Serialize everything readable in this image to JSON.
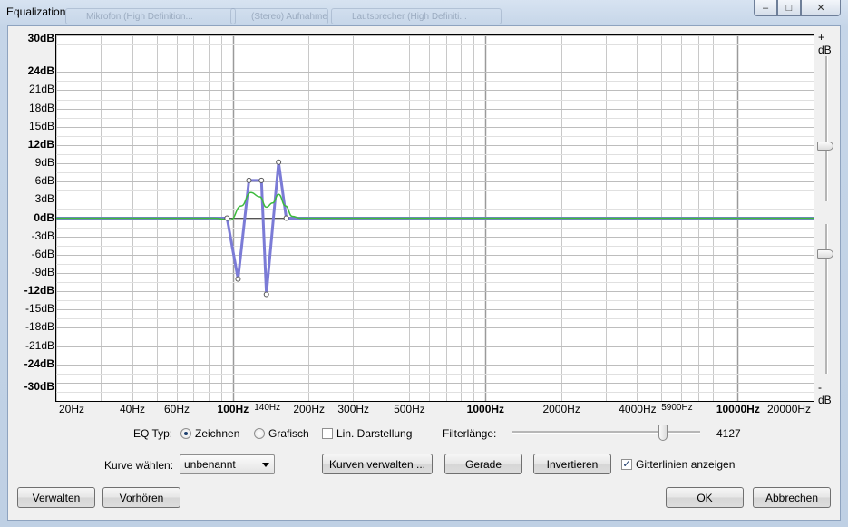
{
  "window": {
    "title": "Equalization",
    "ghost_tabs": [
      "Mikrofon (High Definition...",
      "(Stereo) Aufnahme",
      "Lautsprecher (High Definiti..."
    ]
  },
  "plot": {
    "db_labels": [
      {
        "text": "30dB",
        "bold": true
      },
      {
        "text": "24dB",
        "bold": true
      },
      {
        "text": "21dB",
        "bold": false
      },
      {
        "text": "18dB",
        "bold": false
      },
      {
        "text": "15dB",
        "bold": false
      },
      {
        "text": "12dB",
        "bold": true
      },
      {
        "text": "9dB",
        "bold": false
      },
      {
        "text": "6dB",
        "bold": false
      },
      {
        "text": "3dB",
        "bold": false
      },
      {
        "text": "0dB",
        "bold": true
      },
      {
        "text": "-3dB",
        "bold": false
      },
      {
        "text": "-6dB",
        "bold": false
      },
      {
        "text": "-9dB",
        "bold": false
      },
      {
        "text": "-12dB",
        "bold": true
      },
      {
        "text": "-15dB",
        "bold": false
      },
      {
        "text": "-18dB",
        "bold": false
      },
      {
        "text": "-21dB",
        "bold": false
      },
      {
        "text": "-24dB",
        "bold": true
      },
      {
        "text": "-30dB",
        "bold": true
      }
    ],
    "hz_labels": [
      {
        "text": "20Hz",
        "style": "n"
      },
      {
        "text": "40Hz",
        "style": "n"
      },
      {
        "text": "60Hz",
        "style": "n"
      },
      {
        "text": "100Hz",
        "style": "b"
      },
      {
        "text": "140Hz",
        "style": "s"
      },
      {
        "text": "200Hz",
        "style": "n"
      },
      {
        "text": "300Hz",
        "style": "n"
      },
      {
        "text": "500Hz",
        "style": "n"
      },
      {
        "text": "1000Hz",
        "style": "b"
      },
      {
        "text": "2000Hz",
        "style": "n"
      },
      {
        "text": "4000Hz",
        "style": "n"
      },
      {
        "text": "5900Hz",
        "style": "s"
      },
      {
        "text": "10000Hz",
        "style": "b"
      },
      {
        "text": "20000Hz",
        "style": "n"
      }
    ],
    "right_top": "+ dB",
    "right_bottom": "- dB",
    "freq_range": [
      20,
      20000
    ],
    "db_range": [
      -30,
      30
    ],
    "curve_color": "#7b7bd6",
    "response_color": "#3cba3c",
    "control_points": [
      {
        "hz": 20,
        "db": 0
      },
      {
        "hz": 95,
        "db": 0
      },
      {
        "hz": 105,
        "db": -10
      },
      {
        "hz": 116,
        "db": 6.2
      },
      {
        "hz": 130,
        "db": 6.2
      },
      {
        "hz": 136,
        "db": -12.5
      },
      {
        "hz": 152,
        "db": 9.2
      },
      {
        "hz": 163,
        "db": 0
      },
      {
        "hz": 20000,
        "db": 0
      }
    ],
    "response_points": [
      {
        "hz": 20,
        "db": 0
      },
      {
        "hz": 85,
        "db": 0
      },
      {
        "hz": 98,
        "db": -0.3
      },
      {
        "hz": 108,
        "db": 2.0
      },
      {
        "hz": 118,
        "db": 4.2
      },
      {
        "hz": 128,
        "db": 3.5
      },
      {
        "hz": 136,
        "db": 1.8
      },
      {
        "hz": 144,
        "db": 2.5
      },
      {
        "hz": 152,
        "db": 3.9
      },
      {
        "hz": 162,
        "db": 2.0
      },
      {
        "hz": 172,
        "db": 0.3
      },
      {
        "hz": 185,
        "db": 0
      },
      {
        "hz": 20000,
        "db": 0
      }
    ],
    "gain_slider_top": 0.62,
    "gain_slider_bottom": 0.2
  },
  "controls": {
    "eq_type_label": "EQ Typ:",
    "draw_label": "Zeichnen",
    "graphic_label": "Grafisch",
    "lin_label": "Lin. Darstellung",
    "filter_length_label": "Filterlänge:",
    "filter_length_value": "4127",
    "filter_length_fraction": 0.8,
    "curve_label": "Kurve wählen:",
    "curve_value": "unbenannt",
    "manage_curves": "Kurven verwalten ...",
    "flat": "Gerade",
    "invert": "Invertieren",
    "grid_label": "Gitterlinien anzeigen",
    "grid_checked": true,
    "draw_selected": true
  },
  "footer": {
    "manage": "Verwalten",
    "preview": "Vorhören",
    "ok": "OK",
    "cancel": "Abbrechen"
  }
}
